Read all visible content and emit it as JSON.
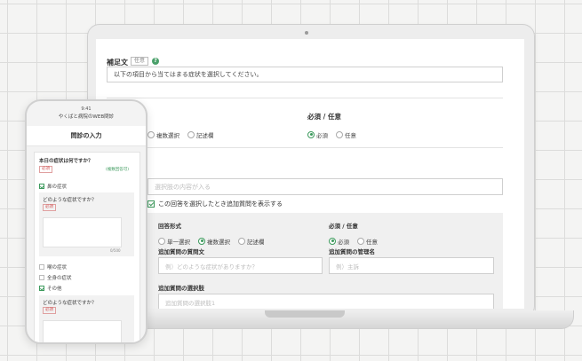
{
  "laptop": {
    "supplement_label": "補足文",
    "optional_tag": "任意",
    "help_icon": "?",
    "supplement_value": "以下の項目から当てはまる症状を選択してください。",
    "answer_format_options": [
      "複数選択",
      "記述欄"
    ],
    "required_label": "必須 / 任意",
    "required_options": [
      "必須",
      "任意"
    ],
    "choice_placeholder": "選択肢の内容が入る",
    "show_followup_label": "この回答を選択したとき追加質問を表示する",
    "panel": {
      "answer_format_label": "回答形式",
      "answer_format_options": [
        "単一選択",
        "複数選択",
        "記述欄"
      ],
      "required_label": "必須 / 任意",
      "required_options": [
        "必須",
        "任意"
      ],
      "question_text_label": "追加質問の質問文",
      "question_text_placeholder": "例）どのような症状がありますか？",
      "admin_name_label": "追加質問の管理名",
      "admin_name_placeholder": "例）主訴",
      "choices_label": "追加質問の選択肢",
      "choices_placeholder": "追加質問の選択肢1"
    }
  },
  "phone": {
    "time": "9:41",
    "site": "やくばと病院のWEB問診",
    "title": "問診の入力",
    "question": "本日の症状は何ですか？",
    "required_badge": "必須",
    "multi_badge": "(複数回答可)",
    "items": [
      "鼻の症状",
      "喉の症状",
      "全身の症状",
      "その他"
    ],
    "followup_question": "どのような症状ですか？",
    "followup_required": "必須",
    "char_count": "0/500",
    "followup_question_2": "どのような症状ですか？",
    "followup_required_2": "必須"
  }
}
